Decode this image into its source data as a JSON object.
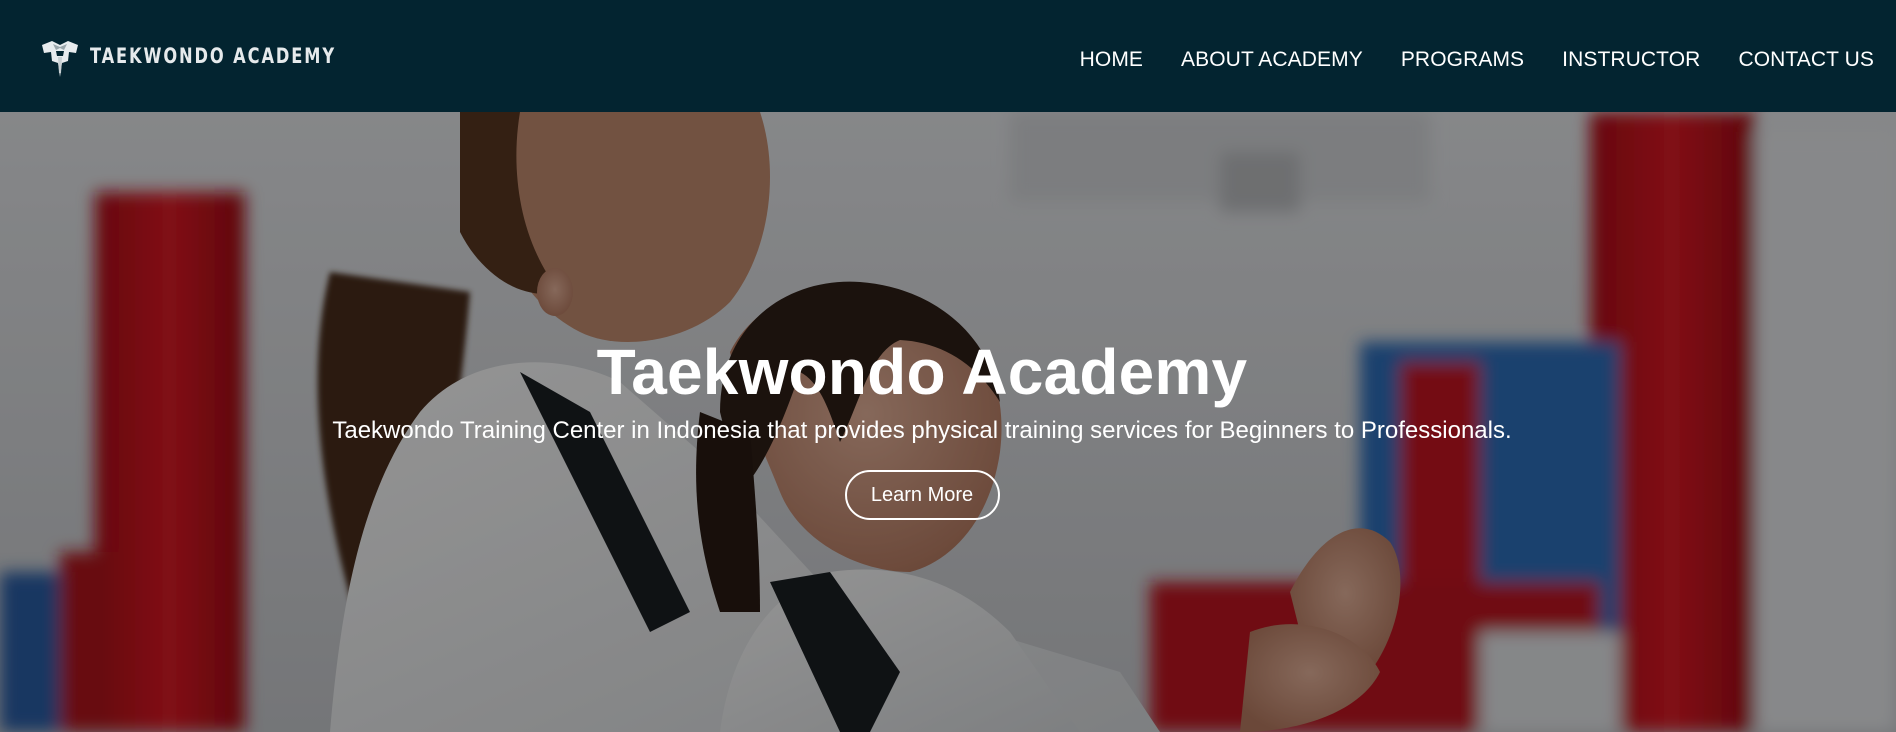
{
  "header": {
    "logo_text": "TAEKWONDO ACADEMY",
    "logo_icon": "fist-dobok-logo-icon",
    "nav": [
      {
        "label": "HOME"
      },
      {
        "label": "ABOUT ACADEMY"
      },
      {
        "label": "PROGRAMS"
      },
      {
        "label": "INSTRUCTOR"
      },
      {
        "label": "CONTACT US"
      }
    ]
  },
  "hero": {
    "title": "Taekwondo Academy",
    "subtitle": "Taekwondo Training Center in Indonesia that provides physical training services for Beginners to Professionals.",
    "button_label": "Learn More",
    "background_image": "instructor guiding student in white dobok, dojo with red mats"
  },
  "colors": {
    "navbar_bg": "#032430",
    "text": "#ffffff",
    "mat_red": "#c6111c"
  }
}
